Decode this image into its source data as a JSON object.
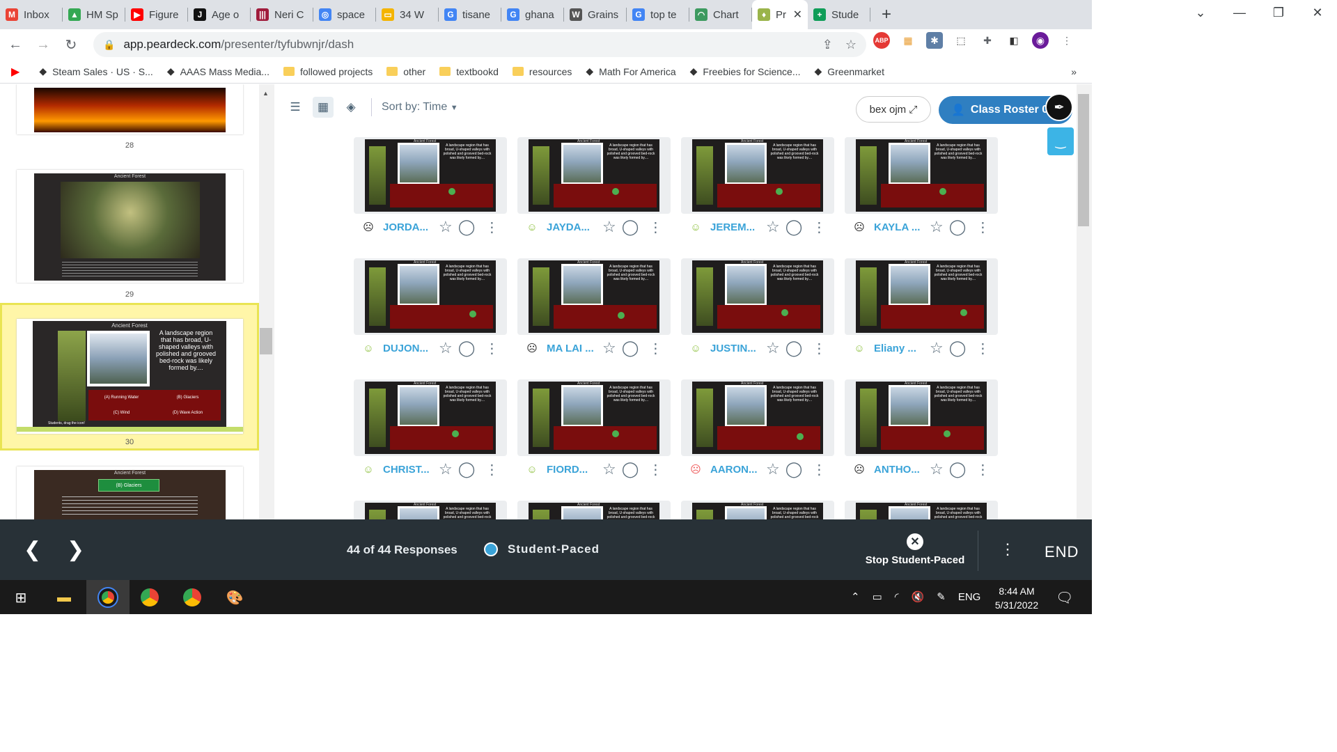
{
  "browser": {
    "tabs": [
      {
        "label": "Inbox",
        "icon": "gmail-icon",
        "color": "#ea4335",
        "glyph": "M"
      },
      {
        "label": "HM Sp",
        "icon": "drive-icon",
        "color": "#34a853",
        "glyph": "▲"
      },
      {
        "label": "Figure",
        "icon": "youtube-icon",
        "color": "#ff0000",
        "glyph": "▶"
      },
      {
        "label": "Age o",
        "icon": "j-icon",
        "color": "#111111",
        "glyph": "J"
      },
      {
        "label": "Neri C",
        "icon": "tab-app-icon",
        "color": "#a01c3c",
        "glyph": "|||"
      },
      {
        "label": "space",
        "icon": "google-lens-icon",
        "color": "#4285f4",
        "glyph": "◎"
      },
      {
        "label": "34 W",
        "icon": "slides-icon",
        "color": "#f4b400",
        "glyph": "▭"
      },
      {
        "label": "tisane",
        "icon": "google-icon",
        "color": "#4285f4",
        "glyph": "G"
      },
      {
        "label": "ghana",
        "icon": "google-icon",
        "color": "#4285f4",
        "glyph": "G"
      },
      {
        "label": "Grains",
        "icon": "wikipedia-icon",
        "color": "#555555",
        "glyph": "W"
      },
      {
        "label": "top te",
        "icon": "google-icon",
        "color": "#4285f4",
        "glyph": "G"
      },
      {
        "label": "Chart",
        "icon": "chart-icon",
        "color": "#3c9a5f",
        "glyph": "◠"
      },
      {
        "label": "Pr",
        "icon": "peardeck-icon",
        "color": "#9ab44a",
        "glyph": "♦",
        "active": true
      },
      {
        "label": "Stude",
        "icon": "classroom-plus-icon",
        "color": "#0f9d58",
        "glyph": "+"
      }
    ],
    "new_tab": "+",
    "url_host": "app.peardeck.com",
    "url_path": "/presenter/tyfubwnjr/dash",
    "bookmarks": [
      {
        "label": "",
        "icon": "youtube-icon"
      },
      {
        "label": "Steam Sales · US · S...",
        "icon": "steam-icon"
      },
      {
        "label": "AAAS Mass Media...",
        "icon": "aaas-icon"
      },
      {
        "label": "followed projects",
        "icon": "folder-icon"
      },
      {
        "label": "other",
        "icon": "folder-icon"
      },
      {
        "label": "textbookd",
        "icon": "folder-icon"
      },
      {
        "label": "resources",
        "icon": "folder-icon"
      },
      {
        "label": "Math For America",
        "icon": "mfa-icon"
      },
      {
        "label": "Freebies for Science...",
        "icon": "leaf-icon"
      },
      {
        "label": "Greenmarket",
        "icon": "greenmarket-icon"
      }
    ],
    "bookmarks_more": "»"
  },
  "sidebar": {
    "slides": [
      {
        "num": "28",
        "title": ""
      },
      {
        "num": "29",
        "title": "Ancient Forest"
      },
      {
        "num": "30",
        "title": "Ancient Forest",
        "selected": true
      },
      {
        "num": "",
        "title": "Ancient Forest",
        "answer": "(B) Glaciers"
      }
    ],
    "slide30": {
      "question": "A landscape region that has broad, U-shaped valleys with polished and grooved bed-rock was likely formed by....",
      "options": [
        "(A) Running Water",
        "(B) Glaciers",
        "(C) Wind",
        "(D) Wave Action"
      ],
      "prompt": "Students, drag the icon!"
    }
  },
  "main": {
    "sort_label": "Sort by:",
    "sort_value": "Time",
    "code_button": "bex ojm",
    "roster_button": "Class Roster 0/",
    "card_title": "Ancient Forest",
    "card_text": "A landscape region that has broad, U-shaped valleys with polished and grooved bed-rock was likely formed by....",
    "students": [
      {
        "name": "JORDA...",
        "face": "neutral"
      },
      {
        "name": "JAYDA...",
        "face": "happy"
      },
      {
        "name": "JEREM...",
        "face": "happy"
      },
      {
        "name": "KAYLA ...",
        "face": "neutral"
      },
      {
        "name": "DUJON...",
        "face": "happy"
      },
      {
        "name": "MA LAI ...",
        "face": "neutral"
      },
      {
        "name": "JUSTIN...",
        "face": "happy"
      },
      {
        "name": "Eliany ...",
        "face": "happy"
      },
      {
        "name": "CHRIST...",
        "face": "happy"
      },
      {
        "name": "FIORD...",
        "face": "happy"
      },
      {
        "name": "AARON...",
        "face": "sad"
      },
      {
        "name": "ANTHO...",
        "face": "neutral"
      }
    ]
  },
  "footer": {
    "responses": "44 of 44 Responses",
    "mode": "Student-Paced",
    "stop_label": "Stop Student-Paced",
    "end_label": "END"
  },
  "taskbar": {
    "language": "ENG",
    "time": "8:44 AM",
    "date": "5/31/2022"
  },
  "colors": {
    "accent": "#2f7fc1",
    "name_blue": "#3aa3d8",
    "footer_bg": "#283137",
    "selected_slide": "#fff6a8"
  }
}
